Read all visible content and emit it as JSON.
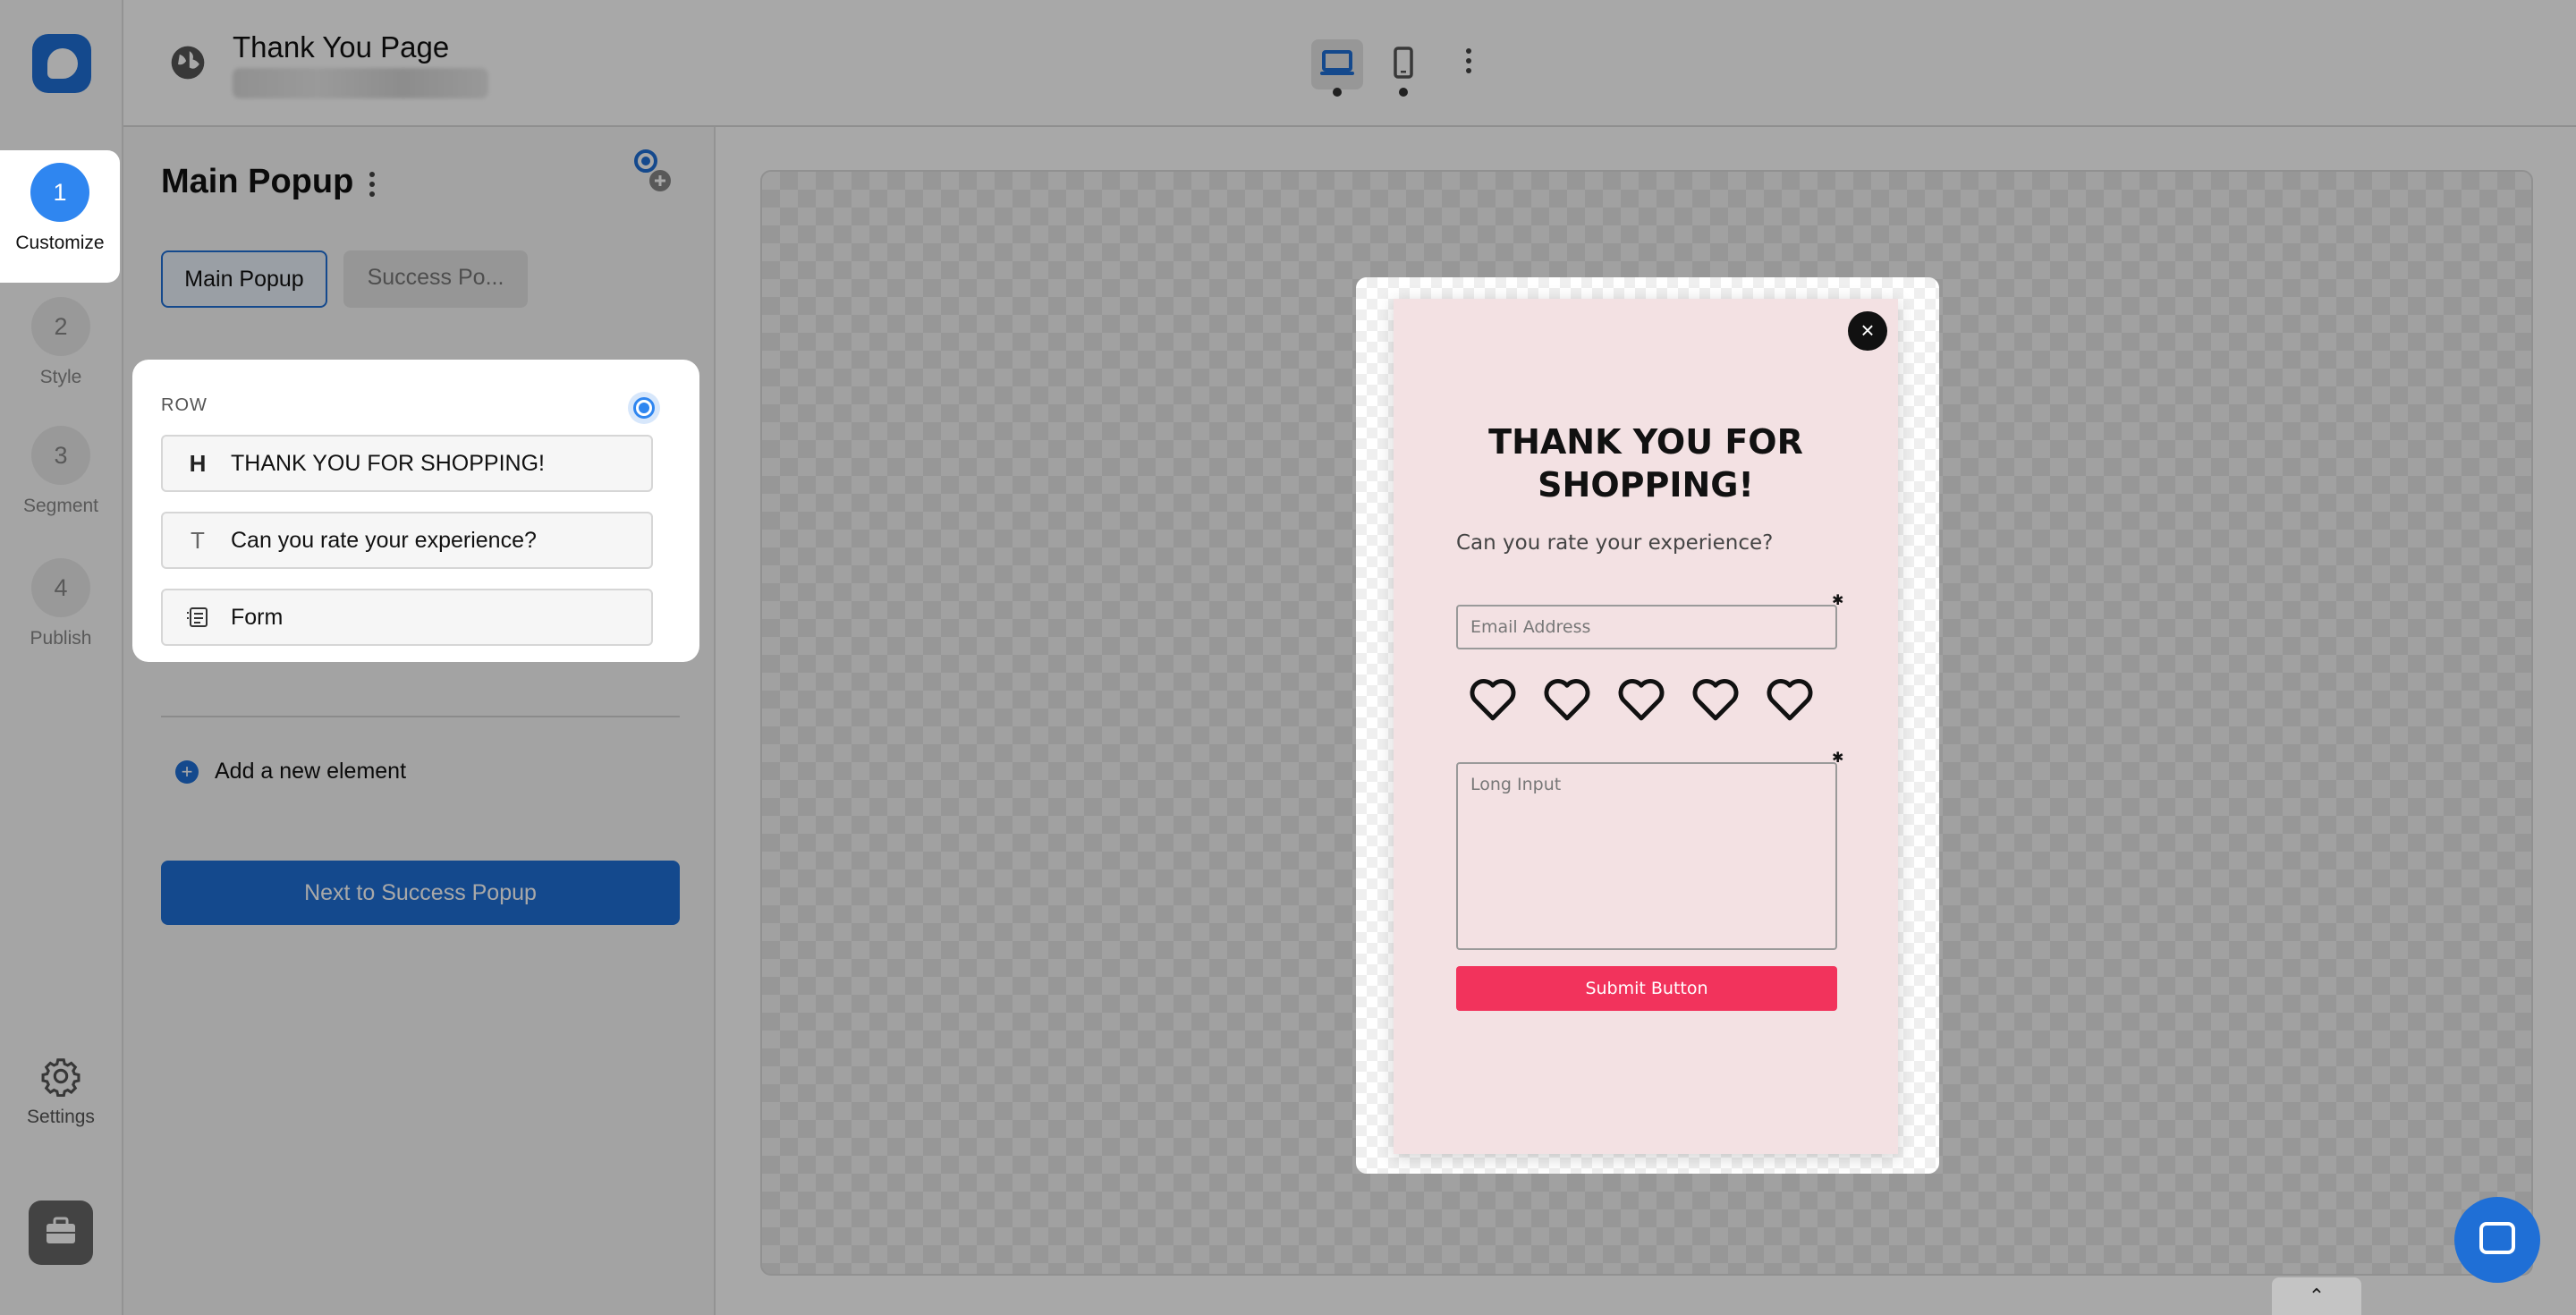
{
  "header": {
    "title": "Thank You Page",
    "device_desktop_icon": "laptop-icon",
    "device_mobile_icon": "phone-icon"
  },
  "steps": [
    {
      "num": "1",
      "label": "Customize"
    },
    {
      "num": "2",
      "label": "Style"
    },
    {
      "num": "3",
      "label": "Segment"
    },
    {
      "num": "4",
      "label": "Publish"
    }
  ],
  "rail": {
    "settings_label": "Settings"
  },
  "panel": {
    "title": "Main Popup",
    "tabs": [
      {
        "label": "Main Popup"
      },
      {
        "label": "Success Po..."
      }
    ],
    "row": {
      "label": "ROW",
      "items": [
        {
          "icon": "H",
          "label": "THANK YOU FOR SHOPPING!"
        },
        {
          "icon": "T",
          "label": "Can you rate your experience?"
        },
        {
          "icon": "form-icon",
          "label": "Form"
        }
      ]
    },
    "add_element": "Add a new element",
    "next_button": "Next to Success Popup"
  },
  "popup": {
    "heading": "THANK YOU FOR SHOPPING!",
    "text": "Can you rate your experience?",
    "email_placeholder": "Email Address",
    "rating_count": 5,
    "long_input_placeholder": "Long Input",
    "submit_label": "Submit Button",
    "close_glyph": "×"
  },
  "colors": {
    "accent": "#1f6fd6",
    "popup_bg": "#f3e1e3",
    "submit_bg": "#f2335c"
  }
}
